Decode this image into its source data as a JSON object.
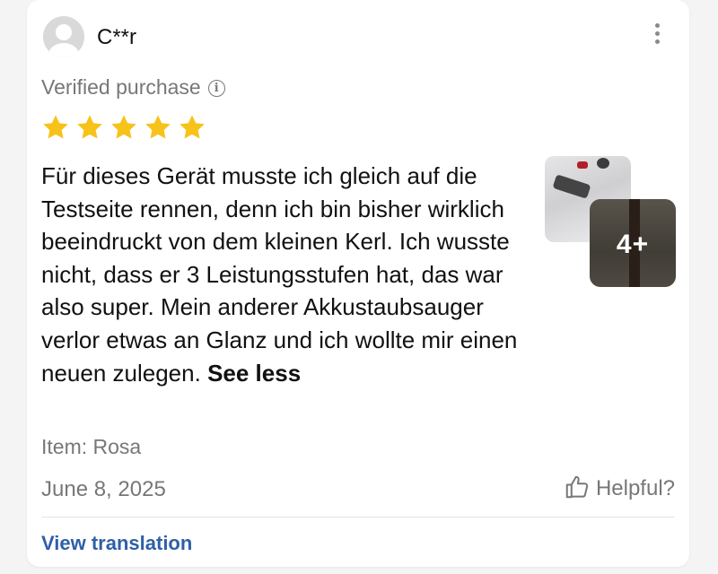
{
  "review": {
    "username": "C**r",
    "verified_label": "Verified purchase",
    "info_glyph": "i",
    "rating": 5,
    "rating_max": 5,
    "star_color": "#f7c21a",
    "text": "Für dieses Gerät musste ich gleich auf die Testseite rennen, denn ich bin bisher wirklich beeindruckt von dem kleinen Kerl. Ich wusste nicht, dass er 3 Leistungsstufen hat, das war also super. Mein anderer Akkustaubsauger verlor etwas an Glanz und ich wollte mir einen neuen zulegen.",
    "see_less_label": "See less",
    "photos_more_label": "4+",
    "item_label": "Item: Rosa",
    "date": "June 8, 2025",
    "helpful_label": "Helpful?",
    "translate_label": "View translation",
    "link_color": "#2f5fa8",
    "icons": [
      "avatar-placeholder",
      "more-vertical-icon",
      "info-icon",
      "star-icon",
      "thumbs-up-icon"
    ]
  }
}
